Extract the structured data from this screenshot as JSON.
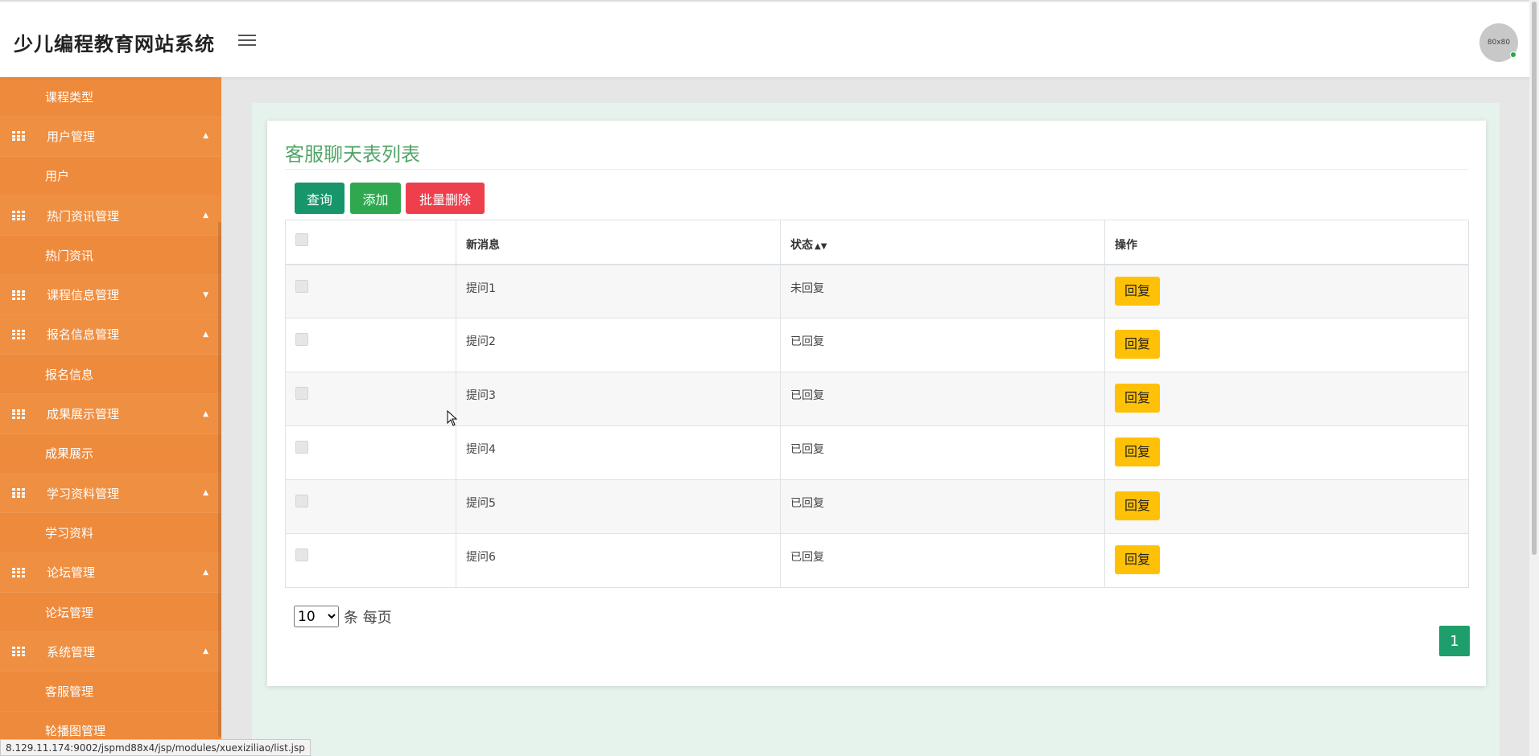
{
  "app": {
    "title": "少儿编程教育网站系统",
    "avatar_text": "80x80"
  },
  "sidebar": {
    "items": [
      {
        "type": "child",
        "label": "课程类型"
      },
      {
        "type": "group",
        "label": "用户管理",
        "caret": "▲"
      },
      {
        "type": "child",
        "label": "用户"
      },
      {
        "type": "group",
        "label": "热门资讯管理",
        "caret": "▲"
      },
      {
        "type": "child",
        "label": "热门资讯"
      },
      {
        "type": "group",
        "label": "课程信息管理",
        "caret": "▼"
      },
      {
        "type": "group",
        "label": "报名信息管理",
        "caret": "▲"
      },
      {
        "type": "child",
        "label": "报名信息"
      },
      {
        "type": "group",
        "label": "成果展示管理",
        "caret": "▲"
      },
      {
        "type": "child",
        "label": "成果展示"
      },
      {
        "type": "group",
        "label": "学习资料管理",
        "caret": "▲"
      },
      {
        "type": "child",
        "label": "学习资料"
      },
      {
        "type": "group",
        "label": "论坛管理",
        "caret": "▲"
      },
      {
        "type": "child",
        "label": "论坛管理"
      },
      {
        "type": "group",
        "label": "系统管理",
        "caret": "▲"
      },
      {
        "type": "child",
        "label": "客服管理"
      },
      {
        "type": "child",
        "label": "轮播图管理"
      }
    ]
  },
  "main": {
    "title": "客服聊天表列表",
    "buttons": {
      "query": "查询",
      "add": "添加",
      "batch_delete": "批量删除"
    },
    "table": {
      "headers": {
        "message": "新消息",
        "status": "状态",
        "action": "操作"
      },
      "rows": [
        {
          "message": "提问1",
          "status": "未回复",
          "action": "回复"
        },
        {
          "message": "提问2",
          "status": "已回复",
          "action": "回复"
        },
        {
          "message": "提问3",
          "status": "已回复",
          "action": "回复"
        },
        {
          "message": "提问4",
          "status": "已回复",
          "action": "回复"
        },
        {
          "message": "提问5",
          "status": "已回复",
          "action": "回复"
        },
        {
          "message": "提问6",
          "status": "已回复",
          "action": "回复"
        }
      ]
    },
    "pagination": {
      "page_size": "10",
      "page_size_suffix": "条 每页",
      "current_page": "1"
    }
  },
  "status_bar": {
    "url": "8.129.11.174:9002/jspmd88x4/jsp/modules/xuexiziliao/list.jsp"
  },
  "colors": {
    "sidebar": "#ee8a3c",
    "title": "#52a468",
    "query_btn": "#16966a",
    "add_btn": "#2fa84f",
    "delete_btn": "#ee3f4d",
    "reply_btn": "#ffc107"
  }
}
